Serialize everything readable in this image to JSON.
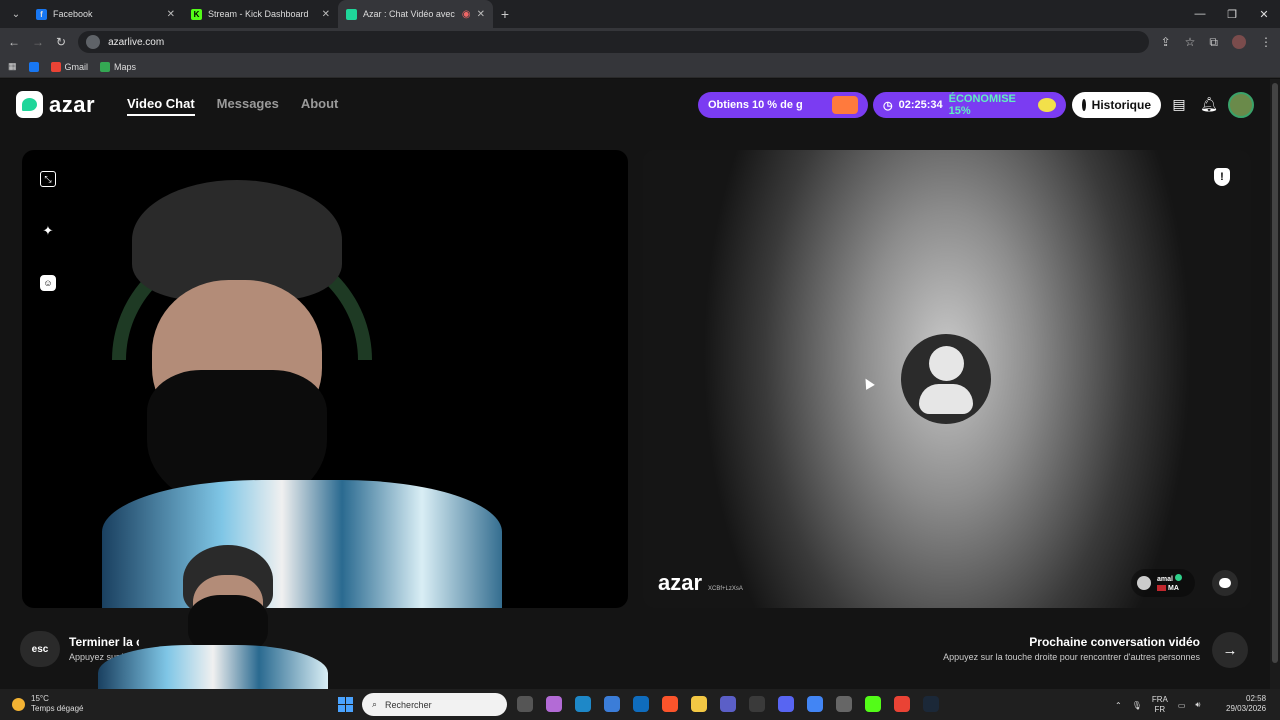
{
  "browser": {
    "tabs": [
      {
        "title": "Facebook",
        "color": "#1877f2"
      },
      {
        "title": "Stream - Kick Dashboard",
        "color": "#53fc18"
      },
      {
        "title": "Azar : Chat Vidéo avec de n",
        "color": "#1fd69a"
      }
    ],
    "url": "azarlive.com",
    "bookmarks": [
      "Gmail",
      "Maps"
    ]
  },
  "app": {
    "logo": "azar",
    "nav": {
      "video_chat": "Video Chat",
      "messages": "Messages",
      "about": "About"
    },
    "promo_label": "Obtiens 10 % de g",
    "timer": "02:25:34",
    "econ_label": "ÉCONOMISE 15%",
    "history_label": "Historique"
  },
  "remote": {
    "watermark": "azar",
    "watermark_code": "XCBf+LzXsA",
    "peer_name": "amal",
    "peer_country": "MA"
  },
  "bottom": {
    "esc": "esc",
    "end_title": "Terminer la c",
    "end_sub": "Appuyez sur l",
    "end_sub_tail": "o.",
    "next_title": "Prochaine conversation vidéo",
    "next_sub": "Appuyez sur la touche droite pour rencontrer d'autres personnes"
  },
  "taskbar": {
    "temp": "15°C",
    "weather": "Temps dégagé",
    "search_placeholder": "Rechercher",
    "lang1": "FRA",
    "lang2": "FR",
    "time": "02:58",
    "date": "29/03/2026"
  }
}
